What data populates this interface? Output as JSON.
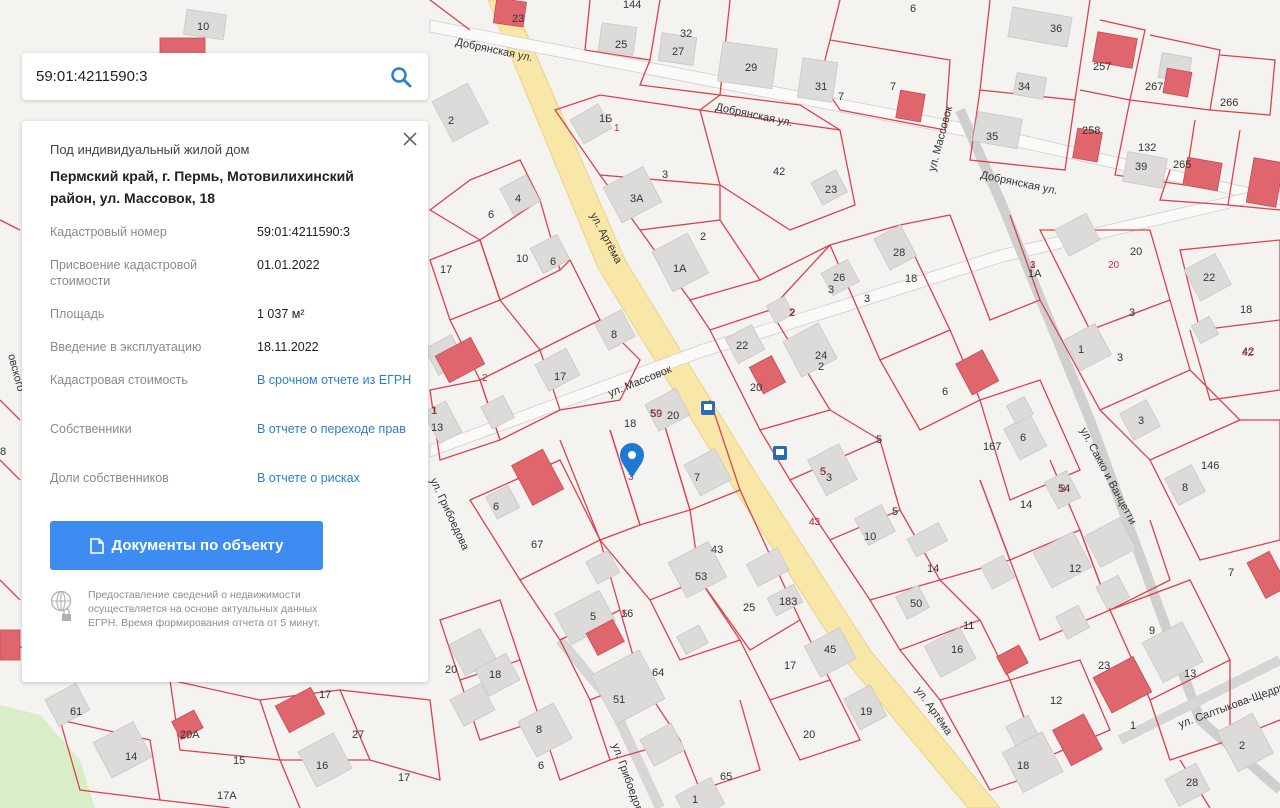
{
  "search": {
    "value": "59:01:4211590:3"
  },
  "card": {
    "type": "Под индивидуальный жилой дом",
    "address": "Пермский край, г. Пермь, Мотовилихинский район, ул. Массовок, 18",
    "rows": [
      {
        "label": "Кадастровый номер",
        "value": "59:01:4211590:3"
      },
      {
        "label": "Присвоение кадастровой стоимости",
        "value": "01.01.2022"
      },
      {
        "label": "Площадь",
        "value": "1 037 м²"
      },
      {
        "label": "Введение в эксплуатацию",
        "value": "18.11.2022"
      },
      {
        "label": "Кадастровая стоимость",
        "value": "В срочном отчете из ЕГРН"
      },
      {
        "label": "Собственники",
        "value": "В отчете о переходе прав"
      },
      {
        "label": "Доли собственников",
        "value": "В отчете о рисках"
      }
    ],
    "docs_button": "Документы по объекту",
    "note": "Предоставление сведений о недвижимости осуществляется на основе актуальных данных ЕГРН. Время формирования отчета от 5 минут.",
    "link_color": "#2d7ecb",
    "button_color": "#3d8cf2"
  },
  "map": {
    "colors": {
      "parcel_line": "#d9434e",
      "building": "#dcdbd9",
      "registered_building": "#e0666e",
      "main_road": "#f7e49a",
      "background": "#f4f3f0",
      "marker": "#1f78d1"
    },
    "streets": [
      "Добрянская ул.",
      "Добрянская ул.",
      "Добрянская ул.",
      "ул. Артёма",
      "ул. Артёма",
      "ул. Массовок",
      "ул. Массовок",
      "ул. Сакко и Ванцетти",
      "ул. Грибоедова",
      "ул. Грибоедова",
      "ул. Салтыкова-Щедрина",
      "овского"
    ],
    "building_numbers": [
      "10",
      "23",
      "144",
      "32",
      "25",
      "27",
      "29",
      "31",
      "7",
      "7",
      "6",
      "36",
      "34",
      "257",
      "267",
      "266",
      "35",
      "258",
      "132",
      "39",
      "265",
      "2",
      "1Б",
      "42",
      "23",
      "3",
      "3А",
      "2",
      "1А",
      "4",
      "6",
      "10",
      "6",
      "8",
      "17",
      "20",
      "28",
      "18",
      "22",
      "1А",
      "26",
      "3",
      "3",
      "22",
      "2",
      "24",
      "3",
      "18",
      "1",
      "3",
      "42",
      "20",
      "2",
      "17",
      "20",
      "59",
      "18",
      "3",
      "5",
      "6",
      "167",
      "6",
      "3",
      "13",
      "1",
      "8",
      "5",
      "146",
      "8",
      "54",
      "14",
      "6",
      "67",
      "7",
      "43",
      "5",
      "10",
      "12",
      "53",
      "14",
      "183",
      "25",
      "7",
      "50",
      "11",
      "5",
      "16",
      "9",
      "16",
      "45",
      "64",
      "17",
      "23",
      "13",
      "51",
      "20",
      "18",
      "19",
      "12",
      "1",
      "61",
      "17",
      "27",
      "20А",
      "8",
      "20",
      "2",
      "14",
      "15",
      "16",
      "6",
      "17",
      "18",
      "28",
      "17А",
      "1",
      "65"
    ],
    "red_numbers": [
      "1",
      "1",
      "20",
      "27",
      "42",
      "43",
      "43",
      "5",
      "5",
      "59",
      "1",
      "3",
      "2",
      "8",
      "3",
      "2"
    ]
  }
}
